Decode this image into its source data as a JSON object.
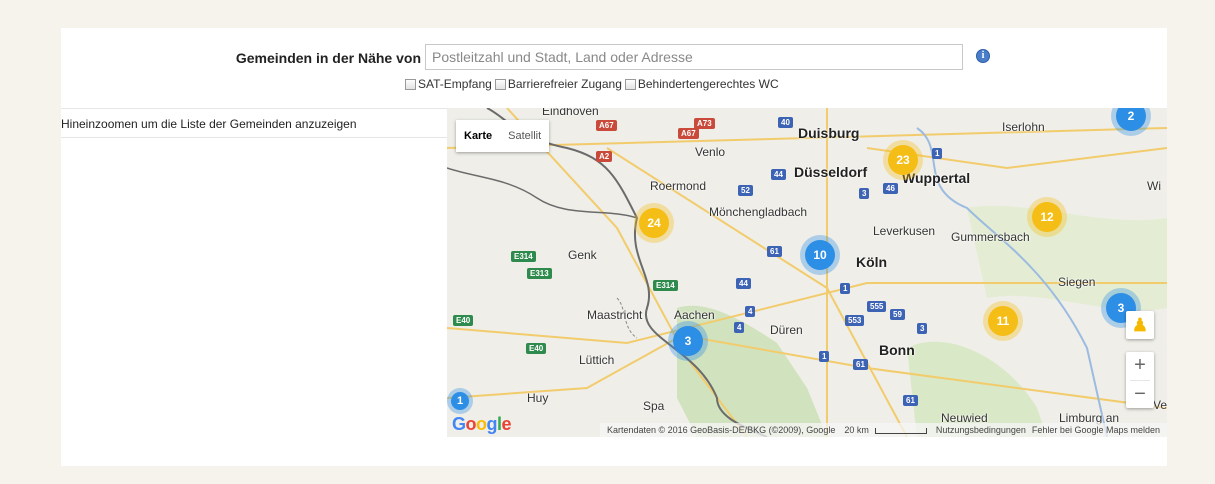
{
  "search": {
    "label": "Gemeinden in der Nähe von",
    "placeholder": "Postleitzahl und Stadt, Land oder Adresse",
    "value": ""
  },
  "filters": [
    {
      "label": "SAT-Empfang",
      "checked": false
    },
    {
      "label": "Barrierefreier Zugang",
      "checked": false
    },
    {
      "label": "Behindertengerechtes WC",
      "checked": false
    }
  ],
  "list": {
    "hint": "Hineinzoomen um die Liste der Gemeinden anzuzeigen"
  },
  "map": {
    "type_controls": [
      {
        "label": "Karte",
        "active": true
      },
      {
        "label": "Satellit",
        "active": false
      }
    ],
    "cities": [
      {
        "name": "Duisburg"
      },
      {
        "name": "Düsseldorf"
      },
      {
        "name": "Wuppertal"
      },
      {
        "name": "Iserlohn"
      },
      {
        "name": "Mönchengladbach"
      },
      {
        "name": "Leverkusen"
      },
      {
        "name": "Gummersbach"
      },
      {
        "name": "Köln"
      },
      {
        "name": "Siegen"
      },
      {
        "name": "Bonn"
      },
      {
        "name": "Aachen"
      },
      {
        "name": "Düren"
      },
      {
        "name": "Maastricht"
      },
      {
        "name": "Lüttich"
      },
      {
        "name": "Venlo"
      },
      {
        "name": "Roermond"
      },
      {
        "name": "Genk"
      },
      {
        "name": "Huy"
      },
      {
        "name": "Spa"
      },
      {
        "name": "Neuwied"
      },
      {
        "name": "Limburg an"
      },
      {
        "name": "Wi"
      },
      {
        "name": "Ve"
      },
      {
        "name": "Eindhoven"
      }
    ],
    "road_shields": [
      {
        "label": "A67",
        "color": "#c94a3a"
      },
      {
        "label": "A67",
        "color": "#c94a3a"
      },
      {
        "label": "A73",
        "color": "#c94a3a"
      },
      {
        "label": "A2",
        "color": "#c94a3a"
      },
      {
        "label": "40",
        "color": "#3d63b5"
      },
      {
        "label": "44",
        "color": "#3d63b5"
      },
      {
        "label": "52",
        "color": "#3d63b5"
      },
      {
        "label": "3",
        "color": "#3d63b5"
      },
      {
        "label": "46",
        "color": "#3d63b5"
      },
      {
        "label": "1",
        "color": "#3d63b5"
      },
      {
        "label": "61",
        "color": "#3d63b5"
      },
      {
        "label": "E314",
        "color": "#2f8a4d"
      },
      {
        "label": "E313",
        "color": "#2f8a4d"
      },
      {
        "label": "E314",
        "color": "#2f8a4d"
      },
      {
        "label": "44",
        "color": "#3d63b5"
      },
      {
        "label": "4",
        "color": "#3d63b5"
      },
      {
        "label": "4",
        "color": "#3d63b5"
      },
      {
        "label": "1",
        "color": "#3d63b5"
      },
      {
        "label": "555",
        "color": "#3d63b5"
      },
      {
        "label": "553",
        "color": "#3d63b5"
      },
      {
        "label": "59",
        "color": "#3d63b5"
      },
      {
        "label": "3",
        "color": "#3d63b5"
      },
      {
        "label": "1",
        "color": "#3d63b5"
      },
      {
        "label": "61",
        "color": "#3d63b5"
      },
      {
        "label": "E40",
        "color": "#2f8a4d"
      },
      {
        "label": "E40",
        "color": "#2f8a4d"
      },
      {
        "label": "61",
        "color": "#3d63b5"
      }
    ],
    "clusters": [
      {
        "count": "2",
        "color": "blue"
      },
      {
        "count": "23",
        "color": "yellow"
      },
      {
        "count": "24",
        "color": "yellow"
      },
      {
        "count": "12",
        "color": "yellow"
      },
      {
        "count": "10",
        "color": "blue"
      },
      {
        "count": "3",
        "color": "blue"
      },
      {
        "count": "11",
        "color": "yellow"
      },
      {
        "count": "3",
        "color": "blue"
      },
      {
        "count": "1",
        "color": "blue"
      }
    ],
    "attribution": {
      "copyright": "Kartendaten © 2016 GeoBasis-DE/BKG (©2009), Google",
      "scale": "20 km",
      "terms": "Nutzungsbedingungen",
      "report": "Fehler bei Google Maps melden"
    },
    "logo": "Google",
    "zoom_in": "+",
    "zoom_out": "−",
    "colors": {
      "cluster_blue": "#2d8ee6",
      "cluster_yellow": "#f5be16",
      "forest": "#c9dfb3",
      "border": "#6b6b6b",
      "motorway": "#f2cc6c"
    }
  }
}
